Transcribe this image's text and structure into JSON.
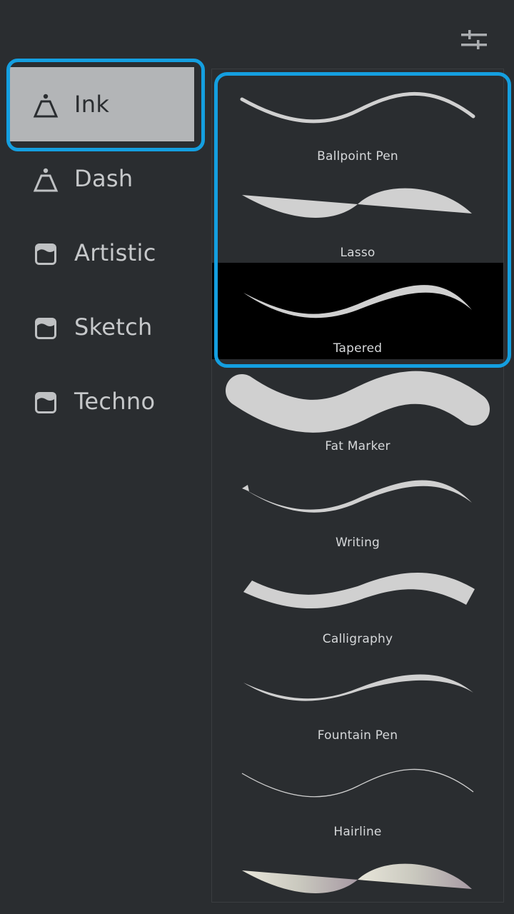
{
  "toolbar": {
    "settings_icon": "sliders-icon"
  },
  "categories": [
    {
      "label": "Ink",
      "icon": "ink-bottle-icon",
      "selected": true
    },
    {
      "label": "Dash",
      "icon": "ink-bottle-icon",
      "selected": false
    },
    {
      "label": "Artistic",
      "icon": "paint-jar-icon",
      "selected": false
    },
    {
      "label": "Sketch",
      "icon": "paint-jar-icon",
      "selected": false
    },
    {
      "label": "Techno",
      "icon": "paint-jar-icon",
      "selected": false
    }
  ],
  "brushes": [
    {
      "name": "Ballpoint Pen"
    },
    {
      "name": "Lasso"
    },
    {
      "name": "Tapered"
    },
    {
      "name": "Fat Marker"
    },
    {
      "name": "Writing"
    },
    {
      "name": "Calligraphy"
    },
    {
      "name": "Fountain Pen"
    },
    {
      "name": "Hairline"
    },
    {
      "name": ""
    }
  ],
  "colors": {
    "accent_highlight": "#149fe0",
    "background": "#2a2d30",
    "selected_category_bg": "#b3b5b7",
    "stroke_preview": "#d0d0d0"
  }
}
